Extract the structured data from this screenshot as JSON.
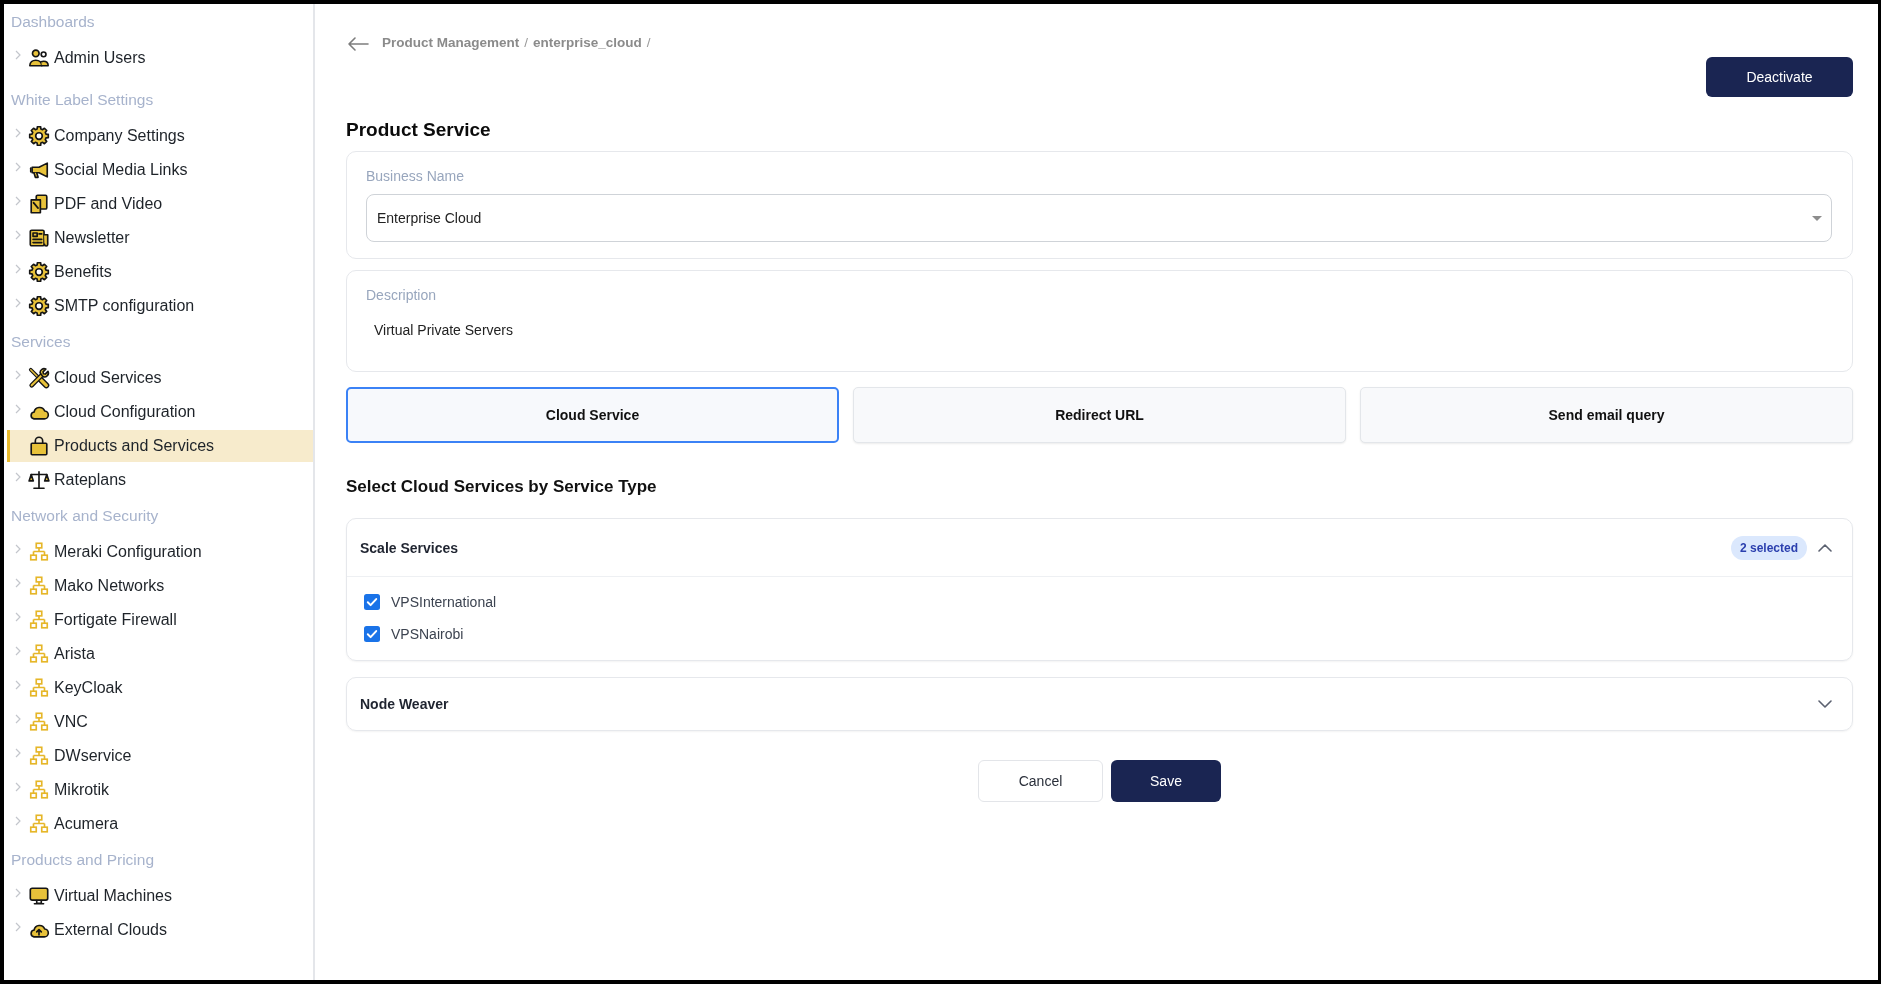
{
  "sidebar": {
    "groups": [
      {
        "title": "Dashboards",
        "items": [
          {
            "label": "Admin Users",
            "kind": "users",
            "selected": false
          }
        ]
      },
      {
        "title": "White Label Settings",
        "items": [
          {
            "label": "Company Settings",
            "kind": "gear",
            "selected": false
          },
          {
            "label": "Social Media Links",
            "kind": "megaphone",
            "selected": false
          },
          {
            "label": "PDF and Video",
            "kind": "files",
            "selected": false
          },
          {
            "label": "Newsletter",
            "kind": "newspaper",
            "selected": false
          },
          {
            "label": "Benefits",
            "kind": "gear",
            "selected": false
          },
          {
            "label": "SMTP configuration",
            "kind": "gear",
            "selected": false
          }
        ]
      },
      {
        "title": "Services",
        "items": [
          {
            "label": "Cloud Services",
            "kind": "tools",
            "selected": false
          },
          {
            "label": "Cloud Configuration",
            "kind": "cloud",
            "selected": false
          },
          {
            "label": "Products and Services",
            "kind": "bag",
            "selected": true
          },
          {
            "label": "Rateplans",
            "kind": "scales",
            "selected": false
          }
        ]
      },
      {
        "title": "Network and Security",
        "items": [
          {
            "label": "Meraki Configuration",
            "kind": "network",
            "selected": false
          },
          {
            "label": "Mako Networks",
            "kind": "network",
            "selected": false
          },
          {
            "label": "Fortigate Firewall",
            "kind": "network",
            "selected": false
          },
          {
            "label": "Arista",
            "kind": "network",
            "selected": false
          },
          {
            "label": "KeyCloak",
            "kind": "network",
            "selected": false
          },
          {
            "label": "VNC",
            "kind": "network",
            "selected": false
          },
          {
            "label": "DWservice",
            "kind": "network",
            "selected": false
          },
          {
            "label": "Mikrotik",
            "kind": "network",
            "selected": false
          },
          {
            "label": "Acumera",
            "kind": "network",
            "selected": false
          }
        ]
      },
      {
        "title": "Products and Pricing",
        "items": [
          {
            "label": "Virtual Machines",
            "kind": "monitor",
            "selected": false
          },
          {
            "label": "External Clouds",
            "kind": "cloud-upload",
            "selected": false
          }
        ]
      }
    ]
  },
  "breadcrumb": [
    {
      "label": "Product Management",
      "separator": "/"
    },
    {
      "label": "enterprise_cloud",
      "separator": "/"
    }
  ],
  "actions": [
    {
      "label": "Deactivate",
      "kind": "primary"
    }
  ],
  "page_title": "Product Service",
  "business_name": {
    "label": "Business Name",
    "value": "Enterprise Cloud"
  },
  "description": {
    "label": "Description",
    "value": "Virtual Private Servers"
  },
  "tabs": [
    {
      "label": "Cloud Service",
      "selected": true
    },
    {
      "label": "Redirect URL",
      "selected": false
    },
    {
      "label": "Send email query",
      "selected": false
    }
  ],
  "section_title": "Select Cloud Services by Service Type",
  "service_groups": [
    {
      "title": "Scale Services",
      "expanded": true,
      "badge": "2 selected",
      "options": [
        {
          "label": "VPSInternational",
          "checked": true
        },
        {
          "label": "VPSNairobi",
          "checked": true
        }
      ]
    },
    {
      "title": "Node Weaver",
      "expanded": false
    }
  ],
  "footer_buttons": [
    {
      "label": "Cancel",
      "kind": "secondary"
    },
    {
      "label": "Save",
      "kind": "primary"
    }
  ]
}
